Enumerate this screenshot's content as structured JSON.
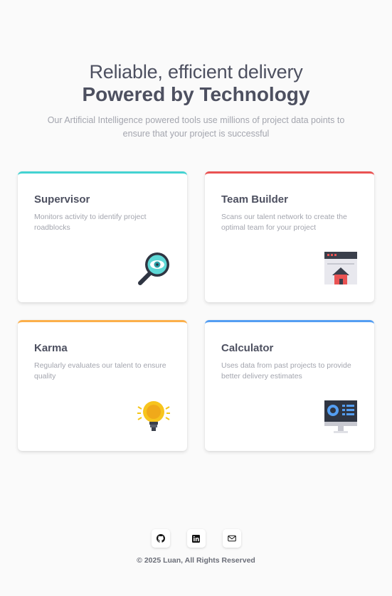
{
  "hero": {
    "line1": "Reliable, efficient delivery",
    "line2": "Powered by Technology",
    "description": "Our Artificial Intelligence powered tools use millions of project data points to ensure that your project is successful"
  },
  "cards": [
    {
      "title": "Supervisor",
      "description": "Monitors activity to identify project roadblocks",
      "accent": "#44d3d2",
      "icon": "magnifier-eye-icon"
    },
    {
      "title": "Team Builder",
      "description": "Scans our talent network to create the optimal team for your project",
      "accent": "#ea5353",
      "icon": "browser-home-icon"
    },
    {
      "title": "Karma",
      "description": "Regularly evaluates our talent to ensure quality",
      "accent": "#fcaf4a",
      "icon": "lightbulb-icon"
    },
    {
      "title": "Calculator",
      "description": "Uses data from past projects to provide better delivery estimates",
      "accent": "#549ef2",
      "icon": "monitor-dashboard-icon"
    }
  ],
  "footer": {
    "social": [
      "github-icon",
      "linkedin-icon",
      "mail-icon"
    ],
    "copyright": "© 2025 Luan, All Rights Reserved"
  }
}
